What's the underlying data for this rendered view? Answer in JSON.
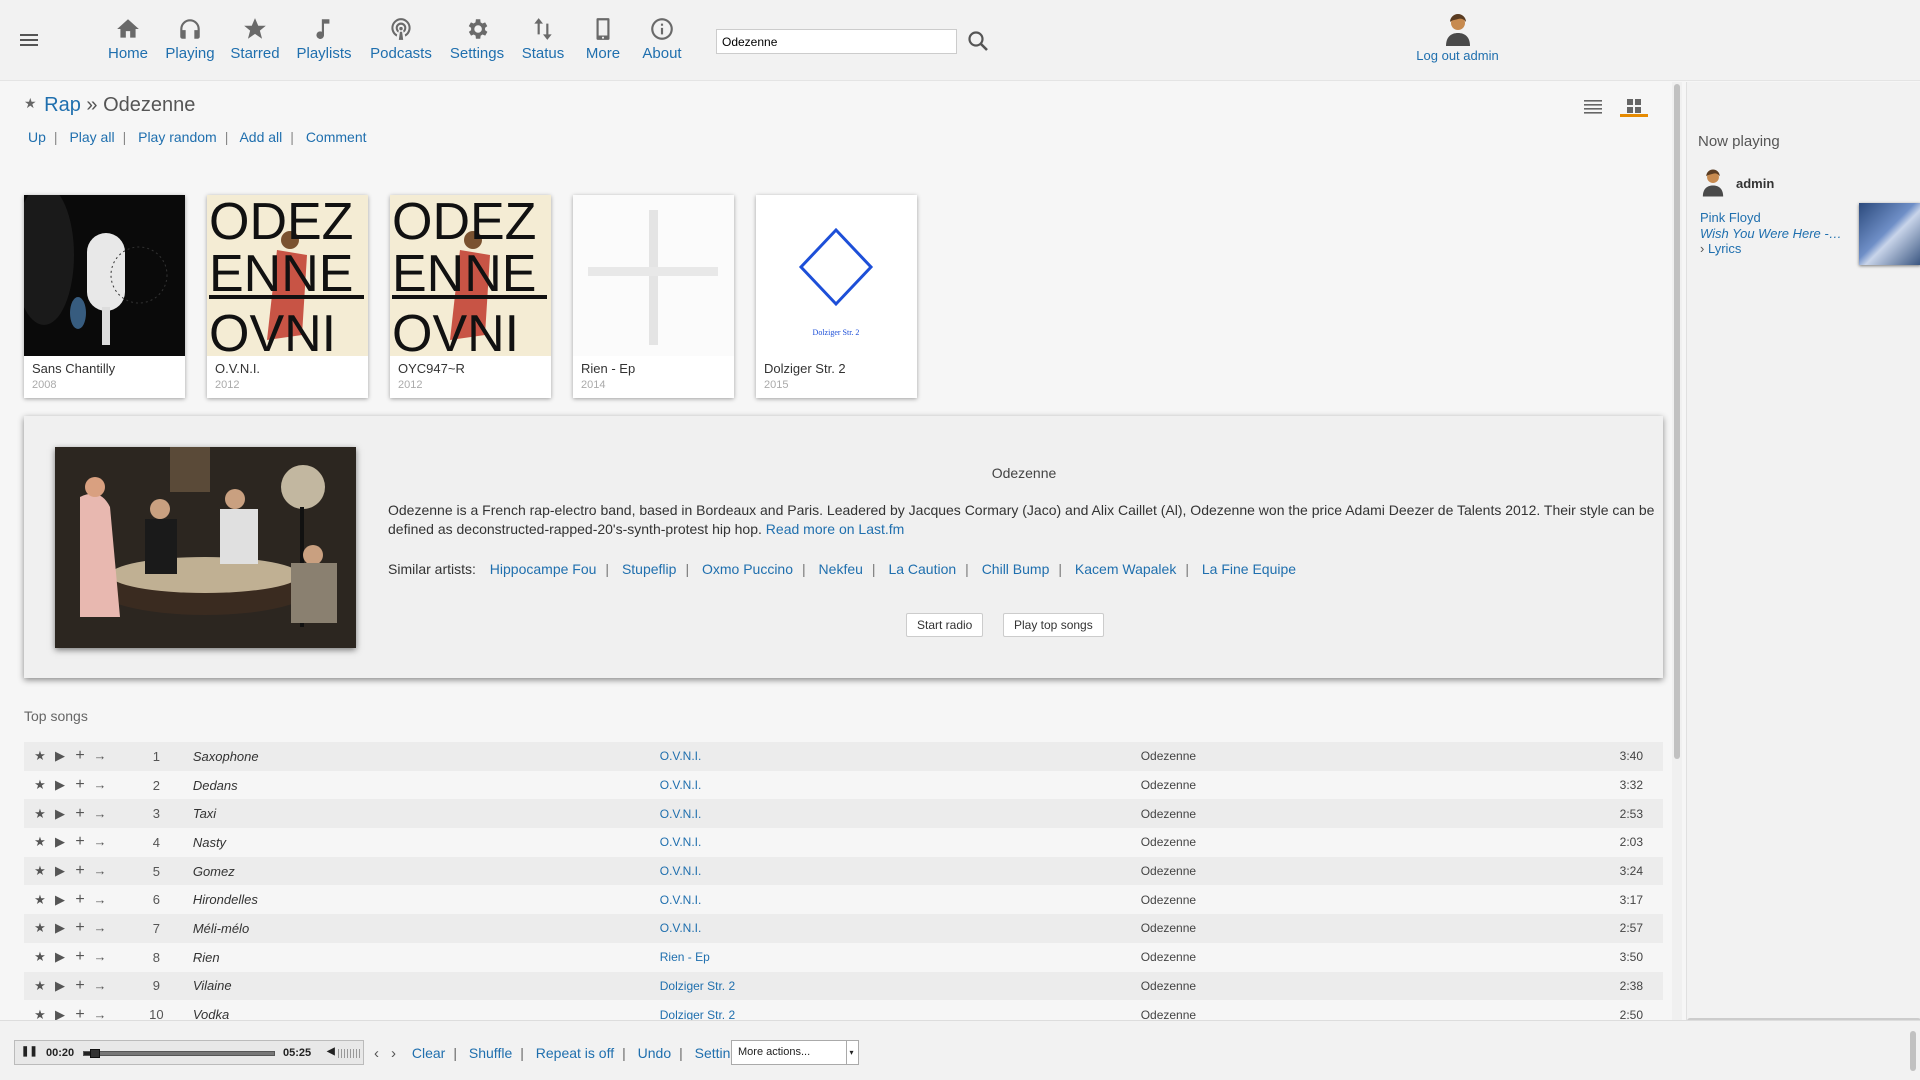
{
  "nav": {
    "items": [
      {
        "label": "Home",
        "icon": "home-icon"
      },
      {
        "label": "Playing",
        "icon": "headphones-icon"
      },
      {
        "label": "Starred",
        "icon": "star-icon"
      },
      {
        "label": "Playlists",
        "icon": "music-note-icon"
      },
      {
        "label": "Podcasts",
        "icon": "podcast-icon"
      },
      {
        "label": "Settings",
        "icon": "gear-icon"
      },
      {
        "label": "Status",
        "icon": "status-arrows-icon"
      },
      {
        "label": "More",
        "icon": "mobile-icon"
      },
      {
        "label": "About",
        "icon": "info-icon"
      }
    ],
    "search_value": "Odezenne",
    "logout_label": "Log out admin"
  },
  "breadcrumb": {
    "genre": "Rap",
    "separator": "»",
    "artist": "Odezenne"
  },
  "actions": [
    "Up",
    "Play all",
    "Play random",
    "Add all",
    "Comment"
  ],
  "albums": [
    {
      "title": "Sans Chantilly",
      "year": "2008"
    },
    {
      "title": "O.V.N.I.",
      "year": "2012"
    },
    {
      "title": "OYC947~R",
      "year": "2012"
    },
    {
      "title": "Rien - Ep",
      "year": "2014"
    },
    {
      "title": "Dolziger Str. 2",
      "year": "2015"
    }
  ],
  "album_cover_text": {
    "ovni": [
      "ODEZ",
      "ENNE",
      "OVNI"
    ],
    "dolziger": "Dolziger Str. 2"
  },
  "artist_info": {
    "name": "Odezenne",
    "bio": "Odezenne is a French rap-electro band, based in Bordeaux and Paris. Leadered by Jacques Cormary (Jaco) and Alix Caillet (Al), Odezenne won the price Adami Deezer de Talents 2012. Their style can be defined as deconstructed-rapped-20's-synth-protest hip hop.",
    "read_more": "Read more on Last.fm",
    "similar_label": "Similar artists:",
    "similar": [
      "Hippocampe Fou",
      "Stupeflip",
      "Oxmo Puccino",
      "Nekfeu",
      "La Caution",
      "Chill Bump",
      "Kacem Wapalek",
      "La Fine Equipe"
    ],
    "start_radio": "Start radio",
    "play_top_songs": "Play top songs"
  },
  "top_songs": {
    "title": "Top songs",
    "rows": [
      {
        "n": "1",
        "title": "Saxophone",
        "album": "O.V.N.I.",
        "artist": "Odezenne",
        "duration": "3:40"
      },
      {
        "n": "2",
        "title": "Dedans",
        "album": "O.V.N.I.",
        "artist": "Odezenne",
        "duration": "3:32"
      },
      {
        "n": "3",
        "title": "Taxi",
        "album": "O.V.N.I.",
        "artist": "Odezenne",
        "duration": "2:53"
      },
      {
        "n": "4",
        "title": "Nasty",
        "album": "O.V.N.I.",
        "artist": "Odezenne",
        "duration": "2:03"
      },
      {
        "n": "5",
        "title": "Gomez",
        "album": "O.V.N.I.",
        "artist": "Odezenne",
        "duration": "3:24"
      },
      {
        "n": "6",
        "title": "Hirondelles",
        "album": "O.V.N.I.",
        "artist": "Odezenne",
        "duration": "3:17"
      },
      {
        "n": "7",
        "title": "Méli-mélo",
        "album": "O.V.N.I.",
        "artist": "Odezenne",
        "duration": "2:57"
      },
      {
        "n": "8",
        "title": "Rien",
        "album": "Rien - Ep",
        "artist": "Odezenne",
        "duration": "3:50"
      },
      {
        "n": "9",
        "title": "Vilaine",
        "album": "Dolziger Str. 2",
        "artist": "Odezenne",
        "duration": "2:38"
      },
      {
        "n": "10",
        "title": "Vodka",
        "album": "Dolziger Str. 2",
        "artist": "Odezenne",
        "duration": "2:50"
      }
    ]
  },
  "now_playing": {
    "title": "Now playing",
    "user": "admin",
    "artist": "Pink Floyd",
    "album": "Wish You Were Here - Wish You Were Here",
    "lyrics": "Lyrics"
  },
  "player": {
    "current_time": "00:20",
    "total_time": "05:25",
    "progress_fraction": 0.06,
    "controls": [
      "Clear",
      "Shuffle",
      "Repeat is off",
      "Undo",
      "Settings"
    ],
    "more_actions": "More actions..."
  },
  "colors": {
    "link": "#1f6fae",
    "accent": "#e68a00"
  }
}
